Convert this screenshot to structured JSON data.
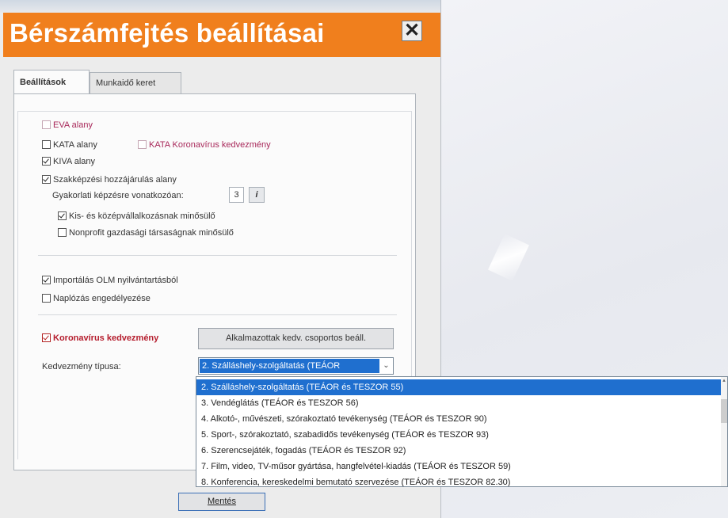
{
  "window": {
    "title": "Bérszámfejtés beállításai",
    "close_symbol": "✕"
  },
  "tabs": [
    {
      "label": "Beállítások",
      "active": true
    },
    {
      "label": "Munkaidő keret",
      "active": false
    }
  ],
  "settings": {
    "eva": {
      "label": "EVA alany",
      "checked": false,
      "enabled": false
    },
    "kata": {
      "label": "KATA alany",
      "checked": false
    },
    "kata_corona": {
      "label": "KATA Koronavírus kedvezmény",
      "checked": false,
      "enabled": false
    },
    "kiva": {
      "label": "KIVA alany",
      "checked": true
    },
    "szakkepzesi": {
      "label": "Szakképzési hozzájárulás alany",
      "checked": true
    },
    "practical": {
      "label": "Gyakorlati képzésre vonatkozóan:",
      "value": "3",
      "info_label": "i"
    },
    "kkv": {
      "label": "Kis- és középvállalkozásnak minősülő",
      "checked": true
    },
    "nonprofit": {
      "label": "Nonprofit gazdasági társaságnak minősülő",
      "checked": false
    },
    "import_olm": {
      "label": "Importálás OLM nyilvántartásból",
      "checked": true
    },
    "logging": {
      "label": "Naplózás engedélyezése",
      "checked": false
    },
    "corona": {
      "label": "Koronavírus kedvezmény",
      "checked": true
    },
    "group_button": "Alkalmazottak kedv. csoportos beáll.",
    "discount_type_label": "Kedvezmény típusa:",
    "discount_type_value": "2. Szálláshely-szolgáltatás (TEÁOR",
    "dropdown_arrow": "⌄"
  },
  "dropdown": {
    "options": [
      {
        "label": "2. Szálláshely-szolgáltatás (TEÁOR és TESZOR 55)",
        "selected": true
      },
      {
        "label": "3. Vendéglátás (TEÁOR és TESZOR 56)",
        "selected": false
      },
      {
        "label": "4. Alkotó-, művészeti, szórakoztató tevékenység (TEÁOR és TESZOR 90)",
        "selected": false
      },
      {
        "label": "5. Sport-, szórakoztató, szabadidős tevékenység (TEÁOR és TESZOR 93)",
        "selected": false
      },
      {
        "label": "6. Szerencsejáték, fogadás (TEÁOR és TESZOR 92)",
        "selected": false
      },
      {
        "label": "7. Film, video, TV-műsor gyártása, hangfelvétel-kiadás (TEÁOR és TESZOR 59)",
        "selected": false
      },
      {
        "label": "8. Konferencia, kereskedelmi bemutató szervezése (TEÁOR és TESZOR 82.30)",
        "selected": false
      }
    ]
  },
  "footer": {
    "save_label": "Mentés"
  },
  "colors": {
    "title_bar": "#f07f1d",
    "selection": "#1f6fcf",
    "accent_red": "#b51d2d",
    "disabled_pink": "#a8285a"
  }
}
